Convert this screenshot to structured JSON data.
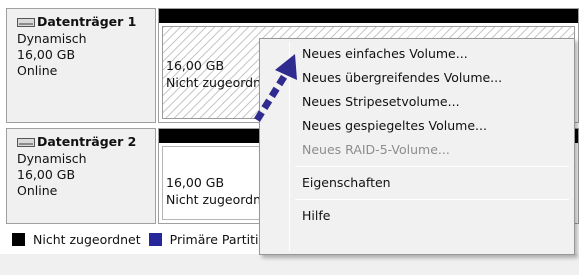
{
  "disks": [
    {
      "name": "Datenträger 1",
      "type": "Dynamisch",
      "size": "16,00 GB",
      "status": "Online",
      "volume": {
        "size": "16,00 GB",
        "state": "Nicht zugeordnet"
      },
      "icon": "hard-disk-icon"
    },
    {
      "name": "Datenträger 2",
      "type": "Dynamisch",
      "size": "16,00 GB",
      "status": "Online",
      "volume": {
        "size": "16,00 GB",
        "state": "Nicht zugeordnet"
      },
      "icon": "hard-disk-icon"
    }
  ],
  "legend": {
    "unallocated": "Nicht zugeordnet",
    "primary": "Primäre Partition"
  },
  "context_menu": {
    "items": [
      {
        "label": "Neues einfaches Volume...",
        "enabled": true
      },
      {
        "label": "Neues übergreifendes Volume...",
        "enabled": true
      },
      {
        "label": "Neues Stripesetvolume...",
        "enabled": true
      },
      {
        "label": "Neues gespiegeltes Volume...",
        "enabled": true
      },
      {
        "label": "Neues RAID-5-Volume...",
        "enabled": false
      },
      {
        "label": "Eigenschaften",
        "enabled": true
      },
      {
        "label": "Hilfe",
        "enabled": true
      }
    ]
  },
  "colors": {
    "unallocated": "#000000",
    "primary_partition": "#27279c",
    "pointer_arrow": "#2f2b8f"
  }
}
